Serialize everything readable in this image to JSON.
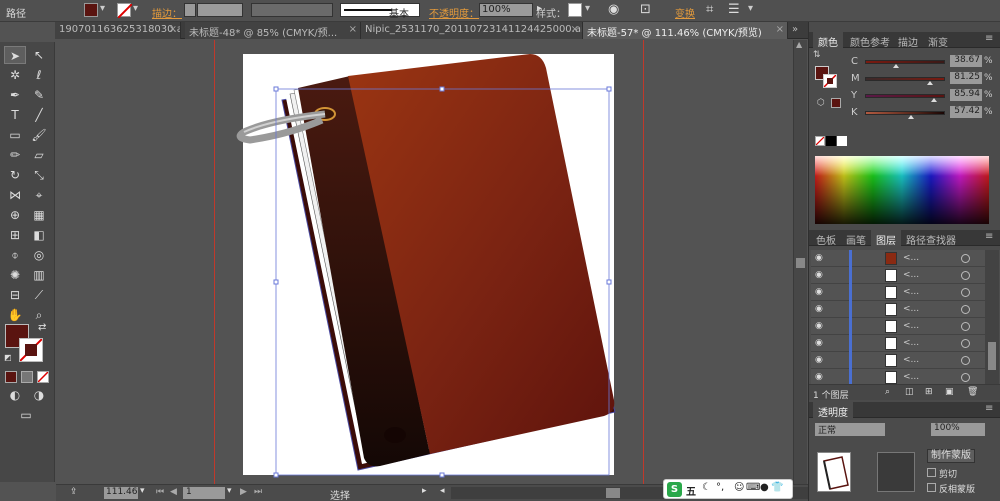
{
  "control_bar": {
    "selection_type": "路径",
    "stroke_label": "描边：",
    "stroke_style": "基本",
    "opacity_label": "不透明度：",
    "opacity_value": "100%",
    "style_label": "样式：",
    "transform_label": "变换",
    "fill_color": "#5a1410"
  },
  "tabs": [
    {
      "label": "190701163625318030.ai*",
      "active": false
    },
    {
      "label": "未标题-48* @ 85% (CMYK/预...",
      "active": false
    },
    {
      "label": "Nipic_2531170_20110723141124425000.ai*",
      "active": false
    },
    {
      "label": "未标题-57* @ 111.46% (CMYK/预览)",
      "active": true
    }
  ],
  "status": {
    "zoom": "111.46",
    "artboard": "1",
    "tool_name": "选择"
  },
  "color_panel": {
    "tabs": [
      "颜色",
      "颜色参考",
      "描边",
      "渐变"
    ],
    "channels": [
      {
        "label": "C",
        "value": "38.67",
        "level": 0.39
      },
      {
        "label": "M",
        "value": "81.25",
        "level": 0.81
      },
      {
        "label": "Y",
        "value": "85.94",
        "level": 0.86
      },
      {
        "label": "K",
        "value": "57.42",
        "level": 0.57
      }
    ],
    "pct": "%",
    "current": "#5a1410"
  },
  "layers_panel": {
    "tabs": [
      "色板",
      "画笔",
      "图层",
      "路径查找器"
    ],
    "item_name": "<...",
    "layer_count": 8,
    "footer": "1 个图层"
  },
  "transparency_panel": {
    "title": "透明度",
    "mode": "正常",
    "opacity": "100%",
    "make_mask": "制作蒙版",
    "clip": "剪切",
    "invert": "反相蒙版"
  },
  "taskbar": {
    "ime": "五"
  }
}
